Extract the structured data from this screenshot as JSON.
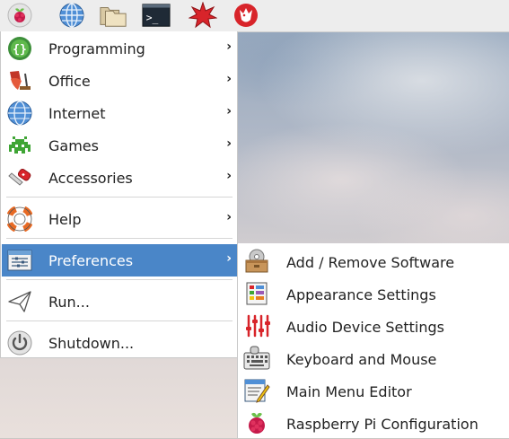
{
  "taskbar": {
    "items": [
      {
        "icon": "raspberry-menu-icon"
      },
      {
        "icon": "web-browser-globe-icon"
      },
      {
        "icon": "file-manager-folders-icon"
      },
      {
        "icon": "terminal-icon",
        "text": ">_"
      },
      {
        "icon": "mathematica-star-icon"
      },
      {
        "icon": "wolfram-icon"
      }
    ]
  },
  "main_menu": {
    "items": [
      {
        "label": "Programming",
        "icon": "programming-braces-icon",
        "submenu": true
      },
      {
        "label": "Office",
        "icon": "office-icon",
        "submenu": true
      },
      {
        "label": "Internet",
        "icon": "internet-globe-icon",
        "submenu": true
      },
      {
        "label": "Games",
        "icon": "games-invader-icon",
        "submenu": true
      },
      {
        "label": "Accessories",
        "icon": "accessories-knife-icon",
        "submenu": true
      },
      {
        "label": "Help",
        "icon": "help-lifebuoy-icon",
        "submenu": true
      },
      {
        "label": "Preferences",
        "icon": "preferences-icon",
        "submenu": true,
        "selected": true
      },
      {
        "label": "Run...",
        "icon": "run-paperplane-icon",
        "submenu": false
      },
      {
        "label": "Shutdown...",
        "icon": "shutdown-power-icon",
        "submenu": false
      }
    ],
    "arrow": "›"
  },
  "preferences_submenu": {
    "items": [
      {
        "label": "Add / Remove Software",
        "icon": "add-remove-software-icon"
      },
      {
        "label": "Appearance Settings",
        "icon": "appearance-settings-icon"
      },
      {
        "label": "Audio Device Settings",
        "icon": "audio-device-settings-icon"
      },
      {
        "label": "Keyboard and Mouse",
        "icon": "keyboard-mouse-icon"
      },
      {
        "label": "Main Menu Editor",
        "icon": "main-menu-editor-icon"
      },
      {
        "label": "Raspberry Pi Configuration",
        "icon": "raspberry-pi-config-icon"
      }
    ]
  },
  "colors": {
    "selection": "#4a86c8",
    "menu_bg": "#ffffff",
    "taskbar_bg": "#ededed",
    "raspberry_red": "#c51a4a",
    "leaf_green": "#6cc04a"
  }
}
